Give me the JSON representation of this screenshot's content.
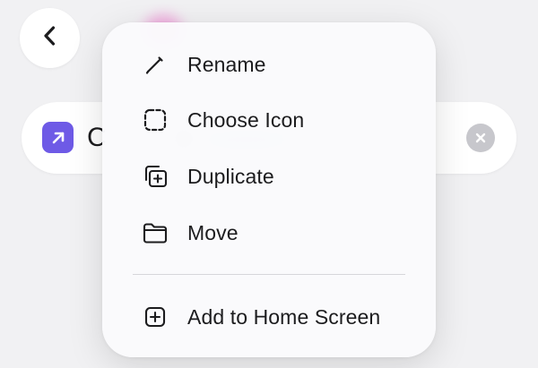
{
  "background": {
    "title_text": "C",
    "accent_color": "#6e5ae6",
    "back_icon": "chevron-left-icon",
    "shortcut_icon": "arrow-up-right-icon",
    "clear_icon": "xmark-circle-icon"
  },
  "menu": {
    "items": [
      {
        "label": "Rename",
        "icon": "pencil-icon"
      },
      {
        "label": "Choose Icon",
        "icon": "dashed-square-icon"
      },
      {
        "label": "Duplicate",
        "icon": "duplicate-icon"
      },
      {
        "label": "Move",
        "icon": "folder-icon"
      }
    ],
    "secondary_items": [
      {
        "label": "Add to Home Screen",
        "icon": "plus-square-icon"
      }
    ]
  }
}
